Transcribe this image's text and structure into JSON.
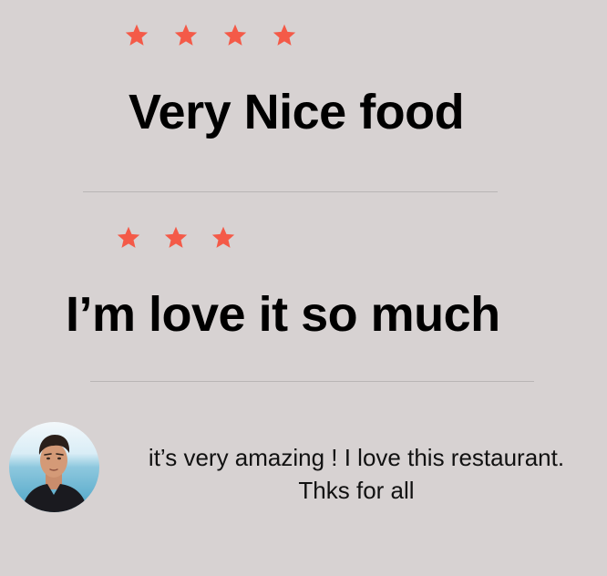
{
  "colors": {
    "background": "#d7d2d2",
    "star": "#f45a48",
    "divider": "#b9b5b5",
    "text": "#000000"
  },
  "reviews": [
    {
      "rating": 4,
      "headline": "Very Nice food"
    },
    {
      "rating": 3,
      "headline": "I’m love it so much"
    }
  ],
  "comment": {
    "avatar_icon": "user-avatar-photo",
    "line1": "it’s very amazing ! I love this restaurant.",
    "line2": "Thks for all"
  }
}
